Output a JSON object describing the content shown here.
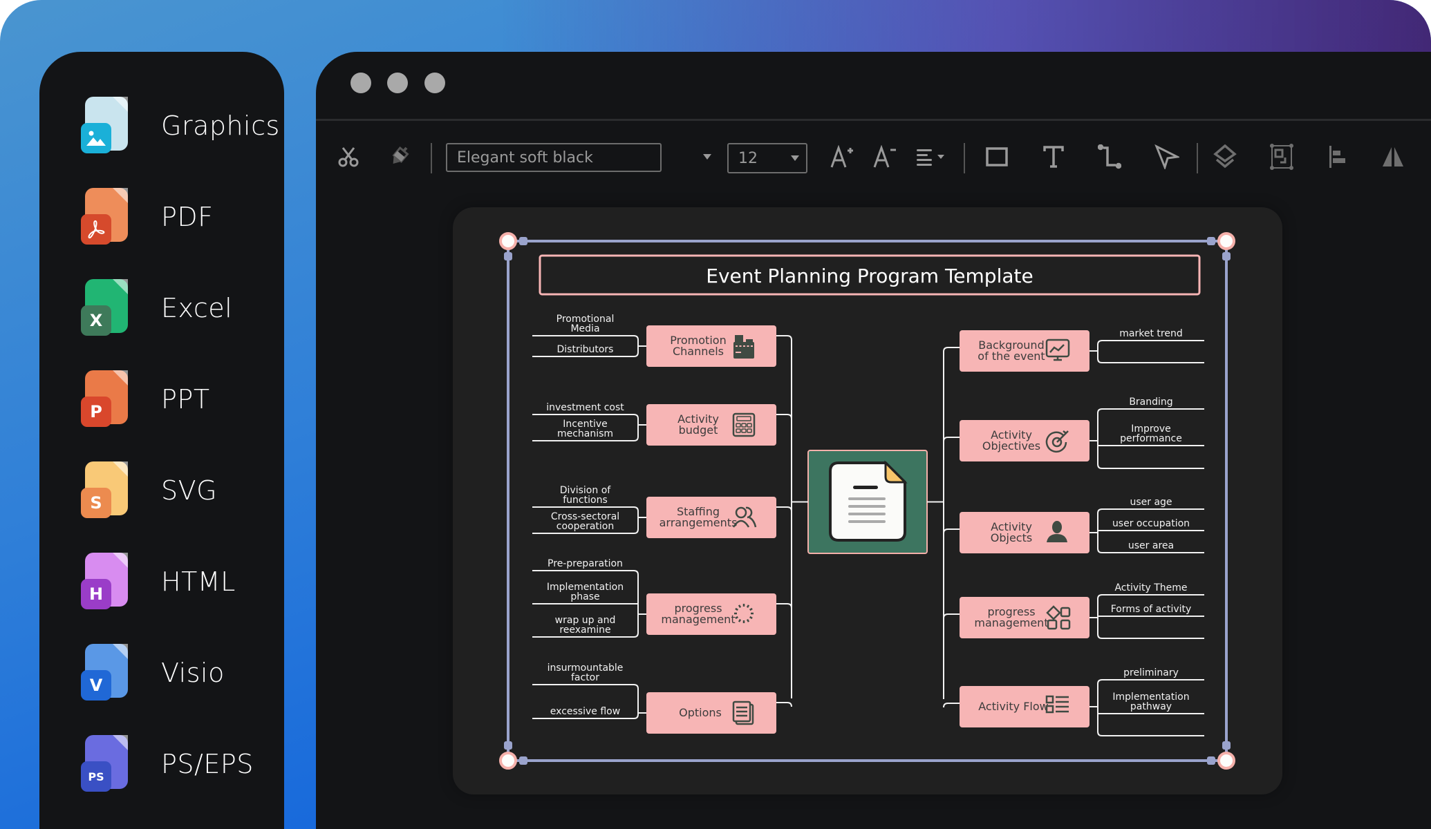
{
  "sidebar": {
    "formats": [
      {
        "label": "Graphics",
        "badge": "",
        "icon": "image-file-icon",
        "back": "#c9e4ee",
        "front": "#1ab0d8"
      },
      {
        "label": "PDF",
        "badge": "",
        "icon": "pdf-file-icon",
        "back": "#ee8d5a",
        "front": "#d64a2c"
      },
      {
        "label": "Excel",
        "badge": "X",
        "icon": "excel-file-icon",
        "back": "#21b573",
        "front": "#3e7a5a"
      },
      {
        "label": "PPT",
        "badge": "P",
        "icon": "ppt-file-icon",
        "back": "#ea7a48",
        "front": "#d9472c"
      },
      {
        "label": "SVG",
        "badge": "S",
        "icon": "svg-file-icon",
        "back": "#f9c977",
        "front": "#ec8b4f"
      },
      {
        "label": "HTML",
        "badge": "H",
        "icon": "html-file-icon",
        "back": "#d88cf0",
        "front": "#9a3dc8"
      },
      {
        "label": "Visio",
        "badge": "V",
        "icon": "visio-file-icon",
        "back": "#5a98e6",
        "front": "#2068d6"
      },
      {
        "label": "PS/EPS",
        "badge": "PS",
        "icon": "ps-file-icon",
        "back": "#6a6ce0",
        "front": "#3a50c4"
      }
    ]
  },
  "toolbar": {
    "font_name": "Elegant soft black",
    "font_size": "12",
    "tools": [
      "cut-icon",
      "format-painter-icon",
      "font-increase-icon",
      "font-decrease-icon",
      "align-icon",
      "rectangle-icon",
      "text-icon",
      "connector-icon",
      "pointer-icon",
      "layers-icon",
      "group-icon",
      "align-left-icon",
      "flip-icon"
    ]
  },
  "diagram": {
    "title": "Event Planning Program Template",
    "center_icon": "document-icon",
    "colors": {
      "node": "#f7b5b5",
      "center": "#3d7560",
      "frame": "#9aa3cc",
      "title_border": "#f7b5b5"
    },
    "left_branches": [
      {
        "label": [
          "Promotion",
          "Channels"
        ],
        "icon": "cash-register-icon",
        "leaves": [
          [
            "Promotional",
            "Media"
          ],
          [
            "Distributors"
          ]
        ]
      },
      {
        "label": [
          "Activity",
          "budget"
        ],
        "icon": "calculator-icon",
        "leaves": [
          [
            "investment cost"
          ],
          [
            "Incentive",
            "mechanism"
          ]
        ]
      },
      {
        "label": [
          "Staffing",
          "arrangements"
        ],
        "icon": "people-icon",
        "leaves": [
          [
            "Division of",
            "functions"
          ],
          [
            "Cross-sectoral",
            "cooperation"
          ]
        ]
      },
      {
        "label": [
          "progress",
          "management"
        ],
        "icon": "loading-icon",
        "leaves": [
          [
            "Pre-preparation"
          ],
          [
            "Implementation",
            "phase"
          ],
          [
            "wrap up and",
            "reexamine"
          ]
        ]
      },
      {
        "label": [
          "Options"
        ],
        "icon": "list-doc-icon",
        "leaves": [
          [
            "insurmountable",
            "factor"
          ],
          [
            "excessive flow"
          ]
        ]
      }
    ],
    "right_branches": [
      {
        "label": [
          "Background",
          "of the event"
        ],
        "icon": "chart-monitor-icon",
        "leaves": [
          [
            "market trend"
          ],
          []
        ]
      },
      {
        "label": [
          "Activity",
          "Objectives"
        ],
        "icon": "target-icon",
        "leaves": [
          [
            "Branding"
          ],
          [
            "Improve",
            "performance"
          ],
          []
        ]
      },
      {
        "label": [
          "Activity",
          "Objects"
        ],
        "icon": "user-icon",
        "leaves": [
          [
            "user age"
          ],
          [
            "user occupation"
          ],
          [
            "user area"
          ]
        ]
      },
      {
        "label": [
          "progress",
          "management"
        ],
        "icon": "shapes-icon",
        "leaves": [
          [
            "Activity Theme"
          ],
          [
            "Forms of activity"
          ],
          []
        ]
      },
      {
        "label": [
          "Activity Flow"
        ],
        "icon": "checklist-icon",
        "leaves": [
          [
            "preliminary"
          ],
          [
            "Implementation",
            "pathway"
          ],
          []
        ]
      }
    ]
  }
}
